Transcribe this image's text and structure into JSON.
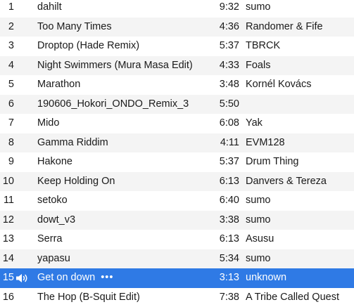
{
  "tracks": [
    {
      "num": "1",
      "title": "dahilt",
      "time": "9:32",
      "artist": "sumo"
    },
    {
      "num": "2",
      "title": "Too Many Times",
      "time": "4:36",
      "artist": "Randomer & Fife"
    },
    {
      "num": "3",
      "title": "Droptop (Hade Remix)",
      "time": "5:37",
      "artist": "TBRCK"
    },
    {
      "num": "4",
      "title": "Night Swimmers (Mura Masa Edit)",
      "time": "4:33",
      "artist": "Foals"
    },
    {
      "num": "5",
      "title": "Marathon",
      "time": "3:48",
      "artist": "Kornél Kovács"
    },
    {
      "num": "6",
      "title": "190606_Hokori_ONDO_Remix_3",
      "time": "5:50",
      "artist": ""
    },
    {
      "num": "7",
      "title": "Mido",
      "time": "6:08",
      "artist": "Yak"
    },
    {
      "num": "8",
      "title": "Gamma Riddim",
      "time": "4:11",
      "artist": "EVM128"
    },
    {
      "num": "9",
      "title": "Hakone",
      "time": "5:37",
      "artist": "Drum Thing"
    },
    {
      "num": "10",
      "title": "Keep Holding On",
      "time": "6:13",
      "artist": "Danvers & Tereza"
    },
    {
      "num": "11",
      "title": "setoko",
      "time": "6:40",
      "artist": "sumo"
    },
    {
      "num": "12",
      "title": "dowt_v3",
      "time": "3:38",
      "artist": "sumo"
    },
    {
      "num": "13",
      "title": "Serra",
      "time": "6:13",
      "artist": "Asusu"
    },
    {
      "num": "14",
      "title": "yapasu",
      "time": "5:34",
      "artist": "sumo"
    },
    {
      "num": "15",
      "title": "Get on down",
      "time": "3:13",
      "artist": "unknown",
      "playing": true,
      "more_label": "•••",
      "icon": "speaker-playing-icon"
    },
    {
      "num": "16",
      "title": "The Hop (B-Squit Edit)",
      "time": "7:38",
      "artist": "A Tribe Called Quest"
    }
  ],
  "colors": {
    "selected_row": "#2f7ae5",
    "striped_row": "#f4f4f4",
    "text": "#1a1a1a",
    "selected_text": "#ffffff"
  }
}
